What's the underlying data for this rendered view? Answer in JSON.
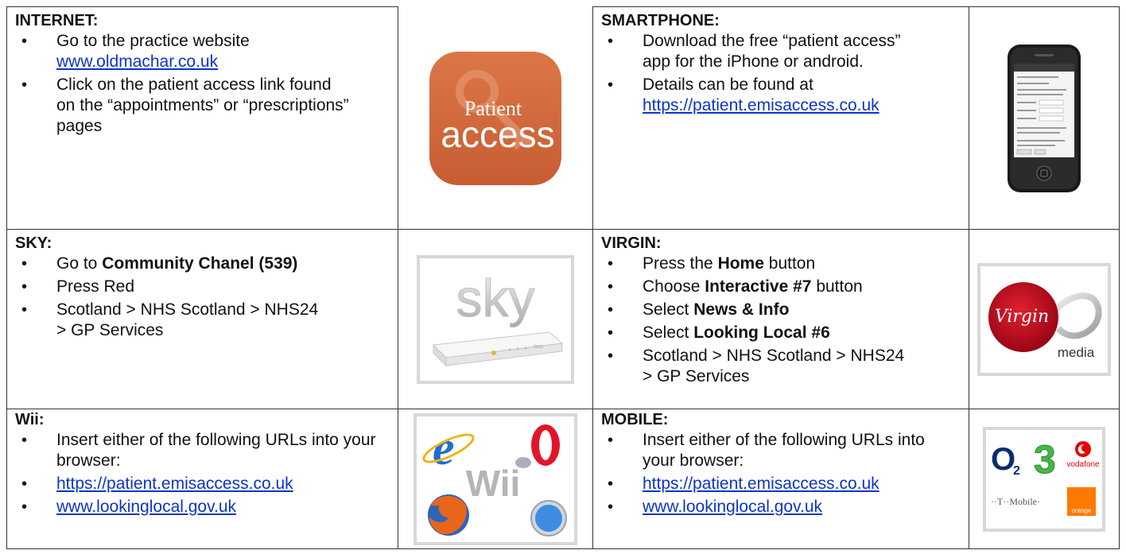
{
  "sections": {
    "internet": {
      "heading": "INTERNET:",
      "b1_text": "Go to the practice website",
      "b1_link": "www.oldmachar.co.uk",
      "b2_text": "Click on the patient access link found on the “appointments” or “prescriptions” pages"
    },
    "smartphone": {
      "heading": "SMARTPHONE:",
      "b1_text": "Download the free “patient access” app for the iPhone or android.",
      "b2_text": "Details can be found at",
      "b2_link": "https://patient.emisaccess.co.uk"
    },
    "sky": {
      "heading": "SKY:",
      "b1_pre": "Go to",
      "b1_bold": "Community Chanel (539)",
      "b2_text": "Press Red",
      "b3_text": "Scotland > NHS Scotland > NHS24 > GP Services"
    },
    "virgin": {
      "heading": "VIRGIN:",
      "b1_pre": "Press the",
      "b1_bold": "Home",
      "b1_post": "button",
      "b2_pre": "Choose",
      "b2_bold": "Interactive #7",
      "b2_post": "button",
      "b3_pre": "Select",
      "b3_bold": "News & Info",
      "b4_pre": "Select",
      "b4_bold": "Looking Local #6",
      "b5_text": "Scotland > NHS Scotland > NHS24 > GP Services"
    },
    "wii": {
      "heading": "Wii:",
      "b1_text": "Insert either of the following URLs into your browser:",
      "b2_link": "https://patient.emisaccess.co.uk",
      "b3_link": "www.lookinglocal.gov.uk"
    },
    "mobile": {
      "heading": "MOBILE:",
      "b1_text": "Insert either of the following URLs into your browser:",
      "b2_link": "https://patient.emisaccess.co.uk",
      "b3_link": "www.lookinglocal.gov.uk"
    }
  },
  "logos": {
    "patient_access": {
      "line1": "Patient",
      "line2": "access",
      "color": "#d4693d"
    },
    "sky": {
      "word": "sky"
    },
    "virgin": {
      "script": "Virgin",
      "word": "media",
      "color": "#b3001b"
    },
    "wii": {
      "word": "Wii"
    },
    "mobile_carriers": {
      "o2": "O",
      "o2_sub": "2",
      "three": "3",
      "vodafone": "vodafone",
      "tmobile": "··T··Mobile·",
      "orange": "orange"
    },
    "colors": {
      "link": "#0b34c9",
      "orange": "#ff7900",
      "vodafone_red": "#e60000",
      "three_green": "#44b649",
      "o2_blue": "#0a2c73"
    }
  }
}
